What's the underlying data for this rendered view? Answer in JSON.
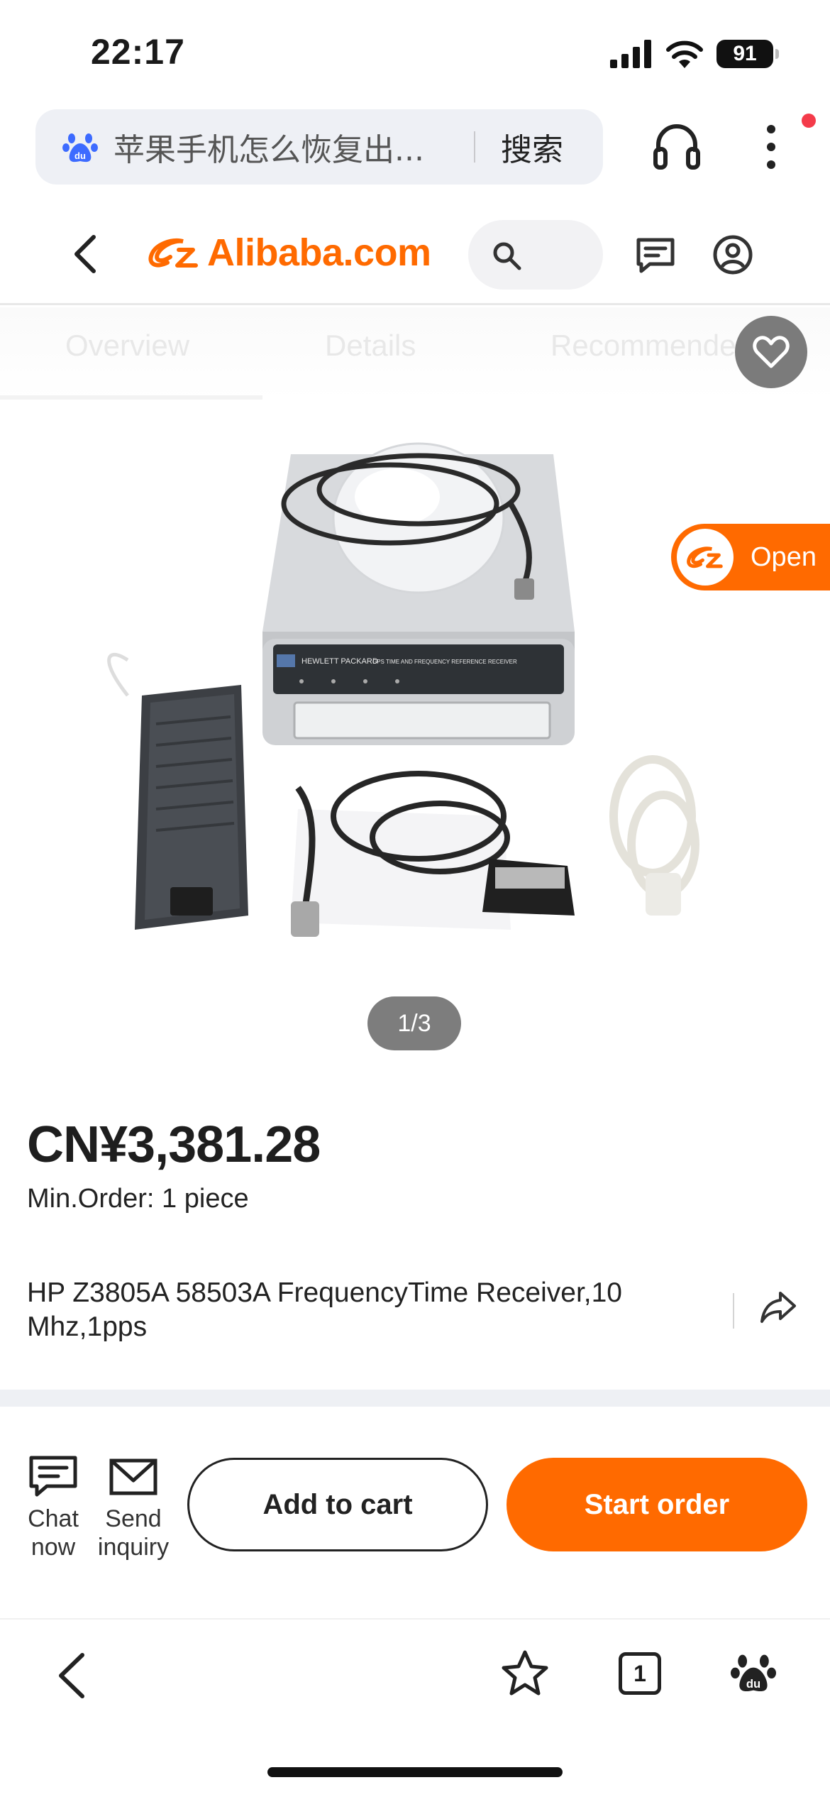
{
  "status_bar": {
    "time": "22:17",
    "battery": "91"
  },
  "browser": {
    "search_query": "苹果手机怎么恢复出...",
    "search_button": "搜索"
  },
  "site": {
    "logo_text": "Alibaba.com"
  },
  "tabs": [
    "Overview",
    "Details",
    "Recommended"
  ],
  "product": {
    "pager": "1/3",
    "price": "CN¥3,381.28",
    "min_order_label": "Min.Order:",
    "min_order_value": "1 piece",
    "title": "HP Z3805A 58503A FrequencyTime Receiver,10 Mhz,1pps",
    "image_label_brand": "HEWLETT PACKARD",
    "image_label_model": "GPS TIME AND FREQUENCY REFERENCE RECEIVER"
  },
  "open_app": {
    "label": "Open"
  },
  "actions": {
    "chat": "Chat now",
    "inquiry": "Send inquiry",
    "add_to_cart": "Add to cart",
    "start_order": "Start order"
  },
  "bottom_bar": {
    "tab_count": "1"
  },
  "colors": {
    "brand": "#ff6a00",
    "baidu_blue": "#3d6bff",
    "notification": "#f43b4a"
  }
}
